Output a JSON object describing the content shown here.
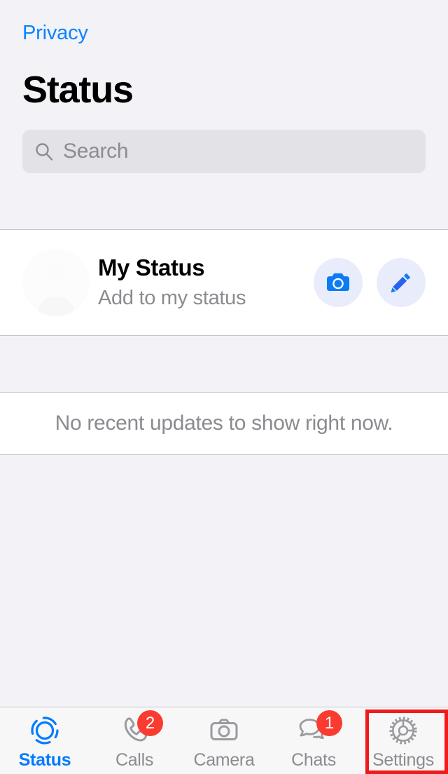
{
  "header": {
    "back_label": "Privacy",
    "title": "Status"
  },
  "search": {
    "placeholder": "Search",
    "value": "",
    "icon": "search-icon"
  },
  "my_status": {
    "title": "My Status",
    "subtitle": "Add to my status",
    "camera_button_icon": "camera-icon",
    "edit_button_icon": "pencil-icon"
  },
  "recent_updates": {
    "empty_message": "No recent updates to show right now."
  },
  "tabbar": {
    "items": [
      {
        "label": "Status",
        "icon": "status-rings-icon",
        "active": true,
        "badge": ""
      },
      {
        "label": "Calls",
        "icon": "phone-icon",
        "active": false,
        "badge": "2"
      },
      {
        "label": "Camera",
        "icon": "camera-outline-icon",
        "active": false,
        "badge": ""
      },
      {
        "label": "Chats",
        "icon": "chat-bubbles-icon",
        "active": false,
        "badge": "1"
      },
      {
        "label": "Settings",
        "icon": "gear-icon",
        "active": false,
        "badge": ""
      }
    ]
  },
  "annotation": {
    "target": "Settings",
    "color": "#ef1b1b"
  },
  "colors": {
    "accent_blue": "#007aff",
    "link_blue": "#0a84ff",
    "badge_red": "#fa3b30",
    "background": "#f2f2f7",
    "card": "#ffffff",
    "secondary_text": "#8b8b90",
    "annotation_red": "#ef1b1b"
  }
}
